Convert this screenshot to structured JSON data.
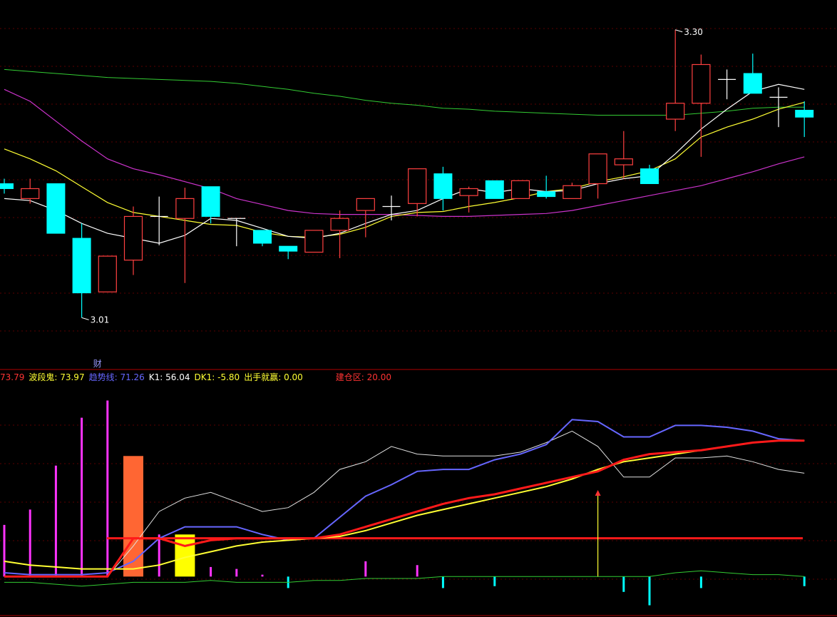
{
  "chart_data": [
    {
      "type": "candlestick",
      "panel": "price",
      "y_range": [
        2.96,
        3.33
      ],
      "grid": true,
      "colors": {
        "up": "#ff4040",
        "down": "#00ffff",
        "flat": "#ffffff",
        "ma_short": "#ffffff",
        "ma_mid": "#ffff33",
        "ma_long": "#cc33cc",
        "ma_slow": "#33cc33"
      },
      "candles": [
        {
          "o": 3.145,
          "c": 3.14,
          "h": 3.15,
          "l": 3.135
        },
        {
          "o": 3.13,
          "c": 3.14,
          "h": 3.15,
          "l": 3.125
        },
        {
          "o": 3.145,
          "c": 3.095,
          "h": 3.145,
          "l": 3.095
        },
        {
          "o": 3.09,
          "c": 3.035,
          "h": 3.105,
          "l": 3.01
        },
        {
          "o": 3.036,
          "c": 3.072,
          "h": 3.072,
          "l": 3.036
        },
        {
          "o": 3.068,
          "c": 3.112,
          "h": 3.122,
          "l": 3.053
        },
        {
          "o": 3.112,
          "c": 3.112,
          "h": 3.132,
          "l": 3.083
        },
        {
          "o": 3.11,
          "c": 3.13,
          "h": 3.141,
          "l": 3.045
        },
        {
          "o": 3.142,
          "c": 3.112,
          "h": 3.142,
          "l": 3.105
        },
        {
          "o": 3.11,
          "c": 3.11,
          "h": 3.11,
          "l": 3.082
        },
        {
          "o": 3.098,
          "c": 3.085,
          "h": 3.098,
          "l": 3.082
        },
        {
          "o": 3.082,
          "c": 3.077,
          "h": 3.082,
          "l": 3.069
        },
        {
          "o": 3.076,
          "c": 3.098,
          "h": 3.098,
          "l": 3.076
        },
        {
          "o": 3.098,
          "c": 3.11,
          "h": 3.118,
          "l": 3.07
        },
        {
          "o": 3.118,
          "c": 3.13,
          "h": 3.13,
          "l": 3.091
        },
        {
          "o": 3.122,
          "c": 3.122,
          "h": 3.133,
          "l": 3.108
        },
        {
          "o": 3.125,
          "c": 3.16,
          "h": 3.16,
          "l": 3.112
        },
        {
          "o": 3.155,
          "c": 3.13,
          "h": 3.162,
          "l": 3.118
        },
        {
          "o": 3.133,
          "c": 3.14,
          "h": 3.142,
          "l": 3.116
        },
        {
          "o": 3.148,
          "c": 3.13,
          "h": 3.148,
          "l": 3.13
        },
        {
          "o": 3.13,
          "c": 3.148,
          "h": 3.148,
          "l": 3.13
        },
        {
          "o": 3.137,
          "c": 3.132,
          "h": 3.153,
          "l": 3.13
        },
        {
          "o": 3.13,
          "c": 3.143,
          "h": 3.146,
          "l": 3.13
        },
        {
          "o": 3.145,
          "c": 3.175,
          "h": 3.175,
          "l": 3.13
        },
        {
          "o": 3.164,
          "c": 3.17,
          "h": 3.198,
          "l": 3.15
        },
        {
          "o": 3.16,
          "c": 3.145,
          "h": 3.164,
          "l": 3.145
        },
        {
          "o": 3.21,
          "c": 3.226,
          "h": 3.3,
          "l": 3.198
        },
        {
          "o": 3.226,
          "c": 3.265,
          "h": 3.275,
          "l": 3.172
        },
        {
          "o": 3.25,
          "c": 3.25,
          "h": 3.26,
          "l": 3.23
        },
        {
          "o": 3.256,
          "c": 3.236,
          "h": 3.276,
          "l": 3.236
        },
        {
          "o": 3.232,
          "c": 3.232,
          "h": 3.242,
          "l": 3.202
        },
        {
          "o": 3.219,
          "c": 3.212,
          "h": 3.228,
          "l": 3.192
        }
      ],
      "ma_short": [
        3.13,
        3.128,
        3.118,
        3.105,
        3.095,
        3.09,
        3.085,
        3.093,
        3.11,
        3.108,
        3.1,
        3.092,
        3.09,
        3.095,
        3.105,
        3.114,
        3.118,
        3.13,
        3.14,
        3.136,
        3.14,
        3.137,
        3.138,
        3.145,
        3.15,
        3.153,
        3.175,
        3.2,
        3.22,
        3.238,
        3.245,
        3.24
      ],
      "ma_mid": [
        3.18,
        3.17,
        3.158,
        3.142,
        3.126,
        3.116,
        3.112,
        3.108,
        3.104,
        3.103,
        3.096,
        3.092,
        3.091,
        3.094,
        3.101,
        3.112,
        3.116,
        3.117,
        3.122,
        3.126,
        3.131,
        3.137,
        3.14,
        3.147,
        3.152,
        3.158,
        3.17,
        3.192,
        3.202,
        3.21,
        3.22,
        3.227
      ],
      "ma_long": [
        3.24,
        3.228,
        3.208,
        3.188,
        3.17,
        3.16,
        3.154,
        3.147,
        3.14,
        3.13,
        3.124,
        3.118,
        3.115,
        3.114,
        3.114,
        3.114,
        3.113,
        3.112,
        3.112,
        3.113,
        3.114,
        3.115,
        3.118,
        3.123,
        3.128,
        3.133,
        3.138,
        3.143,
        3.15,
        3.157,
        3.165,
        3.172
      ],
      "ma_slow": [
        3.26,
        3.258,
        3.256,
        3.254,
        3.252,
        3.251,
        3.25,
        3.249,
        3.248,
        3.246,
        3.243,
        3.24,
        3.236,
        3.233,
        3.229,
        3.226,
        3.224,
        3.221,
        3.22,
        3.218,
        3.217,
        3.216,
        3.215,
        3.214,
        3.214,
        3.214,
        3.214,
        3.216,
        3.218,
        3.221,
        3.222,
        3.222
      ],
      "annotations": [
        {
          "index": 26,
          "price": 3.3,
          "text": "3.30"
        },
        {
          "index": 3,
          "price": 3.01,
          "text": "3.01"
        }
      ],
      "marker_label": {
        "index": 4,
        "text": "财"
      }
    },
    {
      "type": "line",
      "panel": "indicator",
      "y_range": [
        -20,
        100
      ],
      "legend": [
        {
          "name": "",
          "value": "73.79",
          "color": "#ff3333",
          "name_color": "#ff3333"
        },
        {
          "name": "波段鬼",
          "value": "73.97",
          "color": "#ffff33",
          "name_color": "#ffff33"
        },
        {
          "name": "趋势线",
          "value": "71.26",
          "color": "#6666ff",
          "name_color": "#6666ff"
        },
        {
          "name": "K1",
          "value": "56.04",
          "color": "#ffffff",
          "name_color": "#ffffff"
        },
        {
          "name": "DK1",
          "value": "-5.80",
          "color": "#ffff33",
          "name_color": "#ffff33"
        },
        {
          "name": "出手就赢",
          "value": "0.00",
          "color": "#ffff33",
          "name_color": "#ffff33"
        },
        {
          "name": "建仓区",
          "value": "20.00",
          "color": "#ff3333",
          "name_color": "#ff3333"
        }
      ],
      "series": [
        {
          "key": "red",
          "color": "#ff1a1a",
          "width": 3,
          "values": [
            0,
            0,
            0,
            0,
            0,
            20,
            20,
            16,
            19,
            20,
            20,
            20,
            20,
            22,
            26,
            30,
            34,
            38,
            41,
            43,
            46,
            49,
            52,
            55,
            61,
            64,
            65,
            66,
            68,
            70,
            71,
            71
          ]
        },
        {
          "key": "yellow",
          "color": "#ffff33",
          "width": 2,
          "values": [
            8,
            6,
            5,
            4,
            4,
            4,
            6,
            10,
            13,
            16,
            18,
            19,
            20,
            21,
            24,
            28,
            32,
            35,
            38,
            41,
            44,
            47,
            51,
            56,
            60,
            62,
            64,
            66,
            68,
            70,
            71,
            71
          ]
        },
        {
          "key": "blue",
          "color": "#6666ff",
          "width": 2,
          "values": [
            2,
            1,
            1,
            1,
            2,
            8,
            20,
            26,
            26,
            26,
            22,
            19,
            20,
            31,
            42,
            48,
            55,
            56,
            56,
            61,
            64,
            69,
            82,
            81,
            73,
            73,
            79,
            79,
            78,
            76,
            72,
            71
          ]
        },
        {
          "key": "white",
          "color": "#e0e0e0",
          "width": 1,
          "values": [
            null,
            null,
            null,
            null,
            0,
            16,
            34,
            41,
            44,
            39,
            34,
            36,
            44,
            56,
            60,
            68,
            64,
            63,
            63,
            63,
            65,
            70,
            76,
            68,
            52,
            52,
            62,
            62,
            63,
            60,
            56,
            54
          ]
        },
        {
          "key": "green",
          "color": "#33cc33",
          "width": 1,
          "values": [
            -3,
            -3,
            -4,
            -5,
            -4,
            -3,
            -3,
            -3,
            -2,
            -3,
            -3,
            -3,
            -2,
            -2,
            -1,
            -1,
            -1,
            0,
            0,
            0,
            0,
            0,
            0,
            0,
            0,
            0,
            2,
            3,
            2,
            1,
            1,
            0
          ]
        }
      ],
      "hline": {
        "value": 20,
        "color": "#ff1a1a"
      },
      "bars": [
        {
          "index": 0,
          "value": 27,
          "color": "#ff33ff"
        },
        {
          "index": 1,
          "value": 35,
          "color": "#ff33ff"
        },
        {
          "index": 2,
          "value": 58,
          "color": "#ff33ff"
        },
        {
          "index": 3,
          "value": 83,
          "color": "#ff33ff"
        },
        {
          "index": 4,
          "value": 92,
          "color": "#ff33ff"
        },
        {
          "index": 6,
          "value": 22,
          "color": "#ff33ff"
        },
        {
          "index": 8,
          "value": 5,
          "color": "#ff33ff"
        },
        {
          "index": 9,
          "value": 4,
          "color": "#ff33ff"
        },
        {
          "index": 10,
          "value": 1,
          "color": "#ff33ff"
        },
        {
          "index": 14,
          "value": 8,
          "color": "#ff33ff"
        },
        {
          "index": 16,
          "value": 6,
          "color": "#ff33ff"
        },
        {
          "index": 11,
          "value": -6,
          "color": "#00ffff"
        },
        {
          "index": 17,
          "value": -6,
          "color": "#00ffff"
        },
        {
          "index": 19,
          "value": -5,
          "color": "#00ffff"
        },
        {
          "index": 24,
          "value": -8,
          "color": "#00ffff"
        },
        {
          "index": 25,
          "value": -15,
          "color": "#00ffff"
        },
        {
          "index": 27,
          "value": -6,
          "color": "#00ffff"
        },
        {
          "index": 31,
          "value": -5,
          "color": "#00ffff"
        }
      ],
      "blocks": [
        {
          "index": 5,
          "value": 63,
          "color": "#ff6633"
        },
        {
          "index": 7,
          "value": 22,
          "color": "#ffff00"
        }
      ],
      "arrow": {
        "index": 23,
        "from": 0,
        "to": 43,
        "color": "#ffff33"
      }
    }
  ]
}
